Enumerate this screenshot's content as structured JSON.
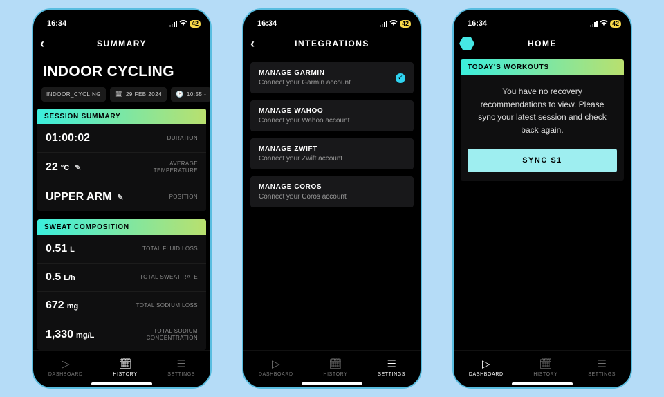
{
  "status": {
    "time": "16:34",
    "battery": "42"
  },
  "p1": {
    "header": "SUMMARY",
    "title": "INDOOR CYCLING",
    "chips": {
      "type": "INDOOR_CYCLING",
      "date": "29 FEB 2024",
      "time": "10:55 -"
    },
    "session_header": "SESSION SUMMARY",
    "session": {
      "duration_val": "01:00:02",
      "duration_lbl": "DURATION",
      "temp_val": "22",
      "temp_unit": "°C",
      "temp_lbl": "AVERAGE TEMPERATURE",
      "pos_val": "UPPER ARM",
      "pos_lbl": "POSITION"
    },
    "sweat_header": "SWEAT COMPOSITION",
    "sweat": {
      "fluid_val": "0.51",
      "fluid_unit": "L",
      "fluid_lbl": "TOTAL FLUID LOSS",
      "rate_val": "0.5",
      "rate_unit": "L/h",
      "rate_lbl": "TOTAL SWEAT RATE",
      "sodium_val": "672",
      "sodium_unit": "mg",
      "sodium_lbl": "TOTAL SODIUM LOSS",
      "conc_val": "1,330",
      "conc_unit": "mg/L",
      "conc_lbl": "TOTAL SODIUM CONCENTRATION"
    },
    "tabs": {
      "dashboard": "DASHBOARD",
      "history": "HISTORY",
      "settings": "SETTINGS"
    }
  },
  "p2": {
    "header": "INTEGRATIONS",
    "items": [
      {
        "title": "MANAGE GARMIN",
        "sub": "Connect your Garmin account",
        "checked": true
      },
      {
        "title": "MANAGE WAHOO",
        "sub": "Connect your Wahoo account",
        "checked": false
      },
      {
        "title": "MANAGE ZWIFT",
        "sub": "Connect your Zwift account",
        "checked": false
      },
      {
        "title": "MANAGE COROS",
        "sub": "Connect your Coros account",
        "checked": false
      }
    ],
    "tabs": {
      "dashboard": "DASHBOARD",
      "history": "HISTORY",
      "settings": "SETTINGS"
    }
  },
  "p3": {
    "header": "HOME",
    "card_header": "TODAY'S WORKOUTS",
    "message": "You have no recovery recommendations to view. Please sync your latest session and check back again.",
    "sync_btn": "SYNC S1",
    "tabs": {
      "dashboard": "DASHBOARD",
      "history": "HISTORY",
      "settings": "SETTINGS"
    }
  }
}
